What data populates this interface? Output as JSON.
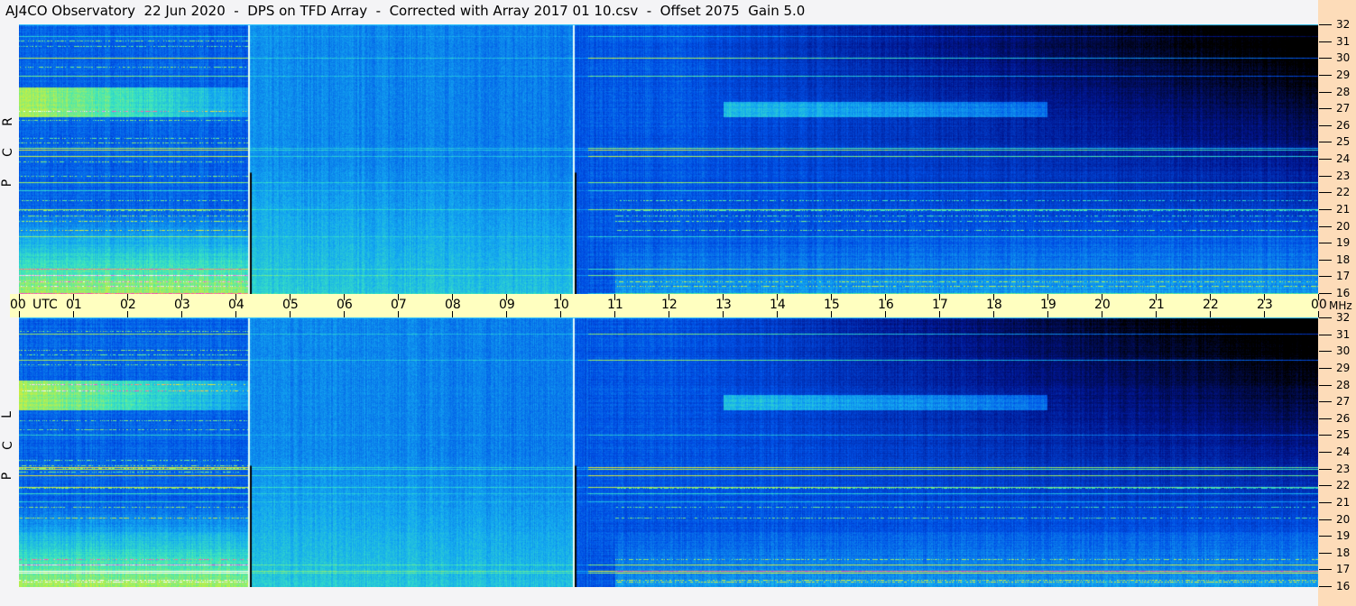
{
  "title": "AJ4CO Observatory  22 Jun 2020  -  DPS on TFD Array  -  Corrected with Array 2017 01 10.csv  -  Offset 2075  Gain 5.0",
  "chart_data": {
    "type": "heatmap",
    "title": "AJ4CO Observatory  22 Jun 2020  -  DPS on TFD Array  -  Corrected with Array 2017 01 10.csv  -  Offset 2075  Gain 5.0",
    "xlabel": "UTC",
    "ylabel": "MHz",
    "x_ticks": [
      "00",
      "01",
      "02",
      "03",
      "04",
      "05",
      "06",
      "07",
      "08",
      "09",
      "10",
      "11",
      "12",
      "13",
      "14",
      "15",
      "16",
      "17",
      "18",
      "19",
      "20",
      "21",
      "22",
      "23",
      "00"
    ],
    "x_range_hours": [
      0,
      24
    ],
    "y_ticks": [
      "32",
      "31",
      "30",
      "29",
      "28",
      "27",
      "26",
      "25",
      "24",
      "23",
      "22",
      "21",
      "20",
      "19",
      "18",
      "17",
      "16"
    ],
    "y_range_mhz": [
      16,
      32
    ],
    "x_unit_label": "UTC",
    "y_unit_label": "MHz",
    "panels": [
      {
        "label": [
          "R",
          "C",
          "P"
        ]
      },
      {
        "label": [
          "L",
          "C",
          "P"
        ]
      }
    ],
    "calibration_markers_hours": [
      4.25,
      10.25
    ]
  }
}
